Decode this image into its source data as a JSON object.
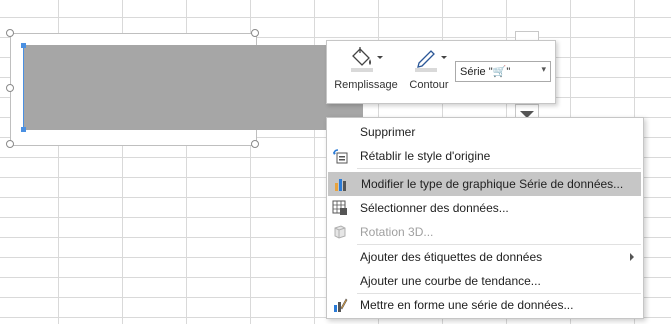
{
  "mini_toolbar": {
    "fill_label": "Remplissage",
    "outline_label": "Contour",
    "series_select_value": "Série \"🛒\""
  },
  "context_menu": {
    "items": [
      {
        "label": "Supprimer",
        "icon": "none",
        "disabled": false
      },
      {
        "label": "Rétablir le style d'origine",
        "icon": "reset-style-icon",
        "disabled": false
      },
      {
        "label": "Modifier le type de graphique Série de données...",
        "icon": "change-chart-type-icon",
        "disabled": false,
        "highlighted": true
      },
      {
        "label": "Sélectionner des données...",
        "icon": "select-data-icon",
        "disabled": false
      },
      {
        "label": "Rotation 3D...",
        "icon": "rotation-3d-icon",
        "disabled": true
      },
      {
        "label": "Ajouter des étiquettes de données",
        "icon": "none",
        "disabled": false,
        "submenu": true
      },
      {
        "label": "Ajouter une courbe de tendance...",
        "icon": "none",
        "disabled": false
      },
      {
        "label": "Mettre en forme une série de données...",
        "icon": "format-series-icon",
        "disabled": false
      }
    ]
  },
  "colors": {
    "bar": "#a6a6a6",
    "highlight": "#c6c6c6",
    "selection_blue": "#4a90e2"
  }
}
